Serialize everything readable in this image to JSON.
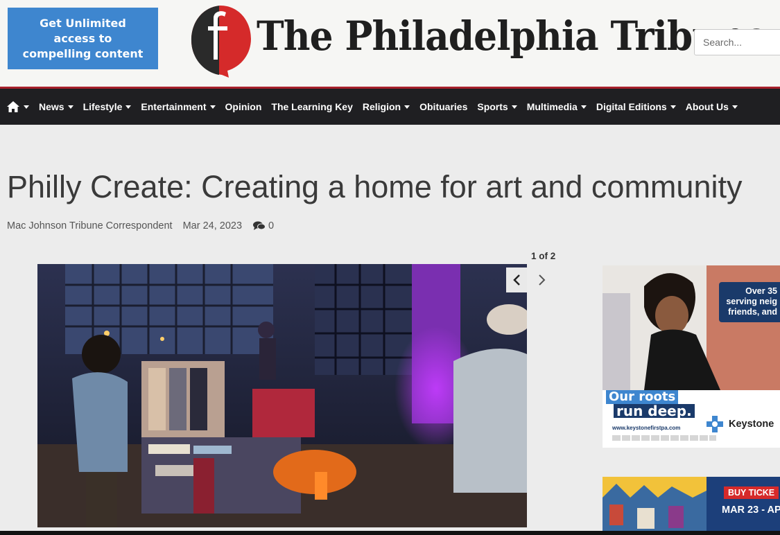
{
  "promo": {
    "text": "Get Unlimited\naccess to\ncompelling content"
  },
  "masthead": {
    "title": "The Philadelphia Tribune"
  },
  "search": {
    "placeholder": "Search..."
  },
  "nav": {
    "items": [
      {
        "label": "News",
        "has_dropdown": true
      },
      {
        "label": "Lifestyle",
        "has_dropdown": true
      },
      {
        "label": "Entertainment",
        "has_dropdown": true
      },
      {
        "label": "Opinion",
        "has_dropdown": false
      },
      {
        "label": "The Learning Key",
        "has_dropdown": false
      },
      {
        "label": "Religion",
        "has_dropdown": true
      },
      {
        "label": "Obituaries",
        "has_dropdown": false
      },
      {
        "label": "Sports",
        "has_dropdown": true
      },
      {
        "label": "Multimedia",
        "has_dropdown": true
      },
      {
        "label": "Digital Editions",
        "has_dropdown": true
      },
      {
        "label": "About Us",
        "has_dropdown": true
      }
    ]
  },
  "article": {
    "headline": "Philly Create: Creating a home for art and community",
    "byline": "Mac Johnson Tribune Correspondent",
    "date": "Mar 24, 2023",
    "comment_count": "0"
  },
  "gallery": {
    "counter": "1 of 2"
  },
  "ads": {
    "keystone": {
      "bubble": "Over 35\nserving neig\nfriends, and",
      "tag_line1": "Our roots",
      "tag_line2": "run deep.",
      "url": "www.keystonefirstpa.com",
      "brand": "Keystone"
    },
    "event": {
      "button": "BUY TICKE",
      "dates": "MAR 23 - AP"
    }
  },
  "colors": {
    "accent_red": "#a8202b",
    "nav_bg": "#1f1f22",
    "promo_blue": "#3e86cf",
    "keystone_navy": "#1a3a6a"
  }
}
